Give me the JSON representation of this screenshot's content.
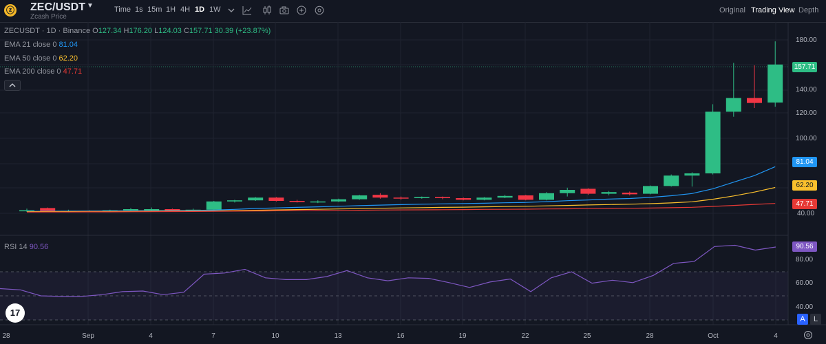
{
  "header": {
    "coin_logo": "zcash-logo-icon",
    "symbol": "ZEC/USDT",
    "subtitle": "Zcash Price",
    "toolbar": [
      "Time",
      "1s",
      "15m",
      "1H",
      "4H",
      "1D",
      "1W"
    ],
    "active_interval": "1D",
    "tool_icons": [
      "chevron-down-icon",
      "indicator-icon",
      "candle-style-icon",
      "camera-icon",
      "plus-circle-icon",
      "settings-icon"
    ],
    "views": [
      "Original",
      "Trading View",
      "Depth"
    ],
    "active_view": "Trading View"
  },
  "legend": {
    "title": "ZECUSDT · 1D · Binance",
    "open_label": "O",
    "open": "127.34",
    "high_label": "H",
    "high": "176.20",
    "low_label": "L",
    "low": "124.03",
    "close_label": "C",
    "close": "157.71",
    "change": "30.39 (+23.87%)",
    "ema21_label": "EMA 21 close 0",
    "ema21": "81.04",
    "ema50_label": "EMA 50 close 0",
    "ema50": "62.20",
    "ema200_label": "EMA 200 close 0",
    "ema200": "47.71"
  },
  "rsi": {
    "label": "RSI 14",
    "value": "90.56"
  },
  "colors": {
    "up": "#26a69a",
    "up_body": "#2ebd85",
    "down": "#f23645",
    "ema21": "#2196f3",
    "ema50": "#fbc02d",
    "ema200": "#e53935",
    "rsi": "#7e57c2",
    "background": "#131722"
  },
  "price_tags": {
    "last": "157.71",
    "ema21": "81.04",
    "ema50": "62.20",
    "ema200": "47.71",
    "rsi": "90.56"
  },
  "price_axis": [
    "180.00",
    "160.00",
    "140.00",
    "120.00",
    "100.00",
    "40.00"
  ],
  "rsi_axis": [
    "80.00",
    "60.00",
    "40.00"
  ],
  "x_axis": [
    "28",
    "Sep",
    "4",
    "7",
    "10",
    "13",
    "16",
    "19",
    "22",
    "25",
    "28",
    "Oct",
    "4"
  ],
  "bottom_buttons": {
    "auto": "A",
    "log": "L"
  },
  "chart_data": {
    "type": "candlestick",
    "title": "ZECUSDT · 1D · Binance",
    "ylim": [
      36,
      186
    ],
    "candles": [
      {
        "o": 41.5,
        "h": 43.0,
        "l": 40.0,
        "c": 41.5
      },
      {
        "o": 43.5,
        "h": 44.0,
        "l": 40.5,
        "c": 41.0
      },
      {
        "o": 41.0,
        "h": 42.0,
        "l": 40.0,
        "c": 41.0
      },
      {
        "o": 40.5,
        "h": 41.5,
        "l": 40.0,
        "c": 41.0
      },
      {
        "o": 41.0,
        "h": 42.0,
        "l": 40.0,
        "c": 41.5
      },
      {
        "o": 41.5,
        "h": 43.5,
        "l": 40.5,
        "c": 42.5
      },
      {
        "o": 42.0,
        "h": 44.0,
        "l": 41.0,
        "c": 42.5
      },
      {
        "o": 42.5,
        "h": 43.0,
        "l": 41.0,
        "c": 42.0
      },
      {
        "o": 42.0,
        "h": 43.0,
        "l": 41.0,
        "c": 42.0
      },
      {
        "o": 42.0,
        "h": 50.0,
        "l": 41.5,
        "c": 49.5
      },
      {
        "o": 49.5,
        "h": 51.0,
        "l": 48.5,
        "c": 50.5
      },
      {
        "o": 50.5,
        "h": 53.5,
        "l": 50.0,
        "c": 53.0
      },
      {
        "o": 53.0,
        "h": 53.5,
        "l": 49.5,
        "c": 50.0
      },
      {
        "o": 50.0,
        "h": 51.0,
        "l": 48.5,
        "c": 49.0
      },
      {
        "o": 49.0,
        "h": 50.5,
        "l": 48.0,
        "c": 49.5
      },
      {
        "o": 49.5,
        "h": 52.0,
        "l": 49.0,
        "c": 51.5
      },
      {
        "o": 51.5,
        "h": 55.5,
        "l": 51.0,
        "c": 55.0
      },
      {
        "o": 55.5,
        "h": 57.0,
        "l": 52.0,
        "c": 53.0
      },
      {
        "o": 53.0,
        "h": 54.0,
        "l": 51.0,
        "c": 52.5
      },
      {
        "o": 52.5,
        "h": 54.0,
        "l": 52.0,
        "c": 53.5
      },
      {
        "o": 53.5,
        "h": 54.0,
        "l": 51.5,
        "c": 52.5
      },
      {
        "o": 52.5,
        "h": 53.0,
        "l": 50.5,
        "c": 51.0
      },
      {
        "o": 51.0,
        "h": 53.5,
        "l": 50.5,
        "c": 53.0
      },
      {
        "o": 53.0,
        "h": 55.5,
        "l": 52.5,
        "c": 54.5
      },
      {
        "o": 55.0,
        "h": 55.5,
        "l": 50.5,
        "c": 51.0
      },
      {
        "o": 51.0,
        "h": 58.0,
        "l": 50.5,
        "c": 57.0
      },
      {
        "o": 57.0,
        "h": 62.0,
        "l": 54.0,
        "c": 60.0
      },
      {
        "o": 61.0,
        "h": 61.5,
        "l": 55.5,
        "c": 56.5
      },
      {
        "o": 56.5,
        "h": 59.0,
        "l": 55.0,
        "c": 58.0
      },
      {
        "o": 57.5,
        "h": 58.5,
        "l": 55.0,
        "c": 56.0
      },
      {
        "o": 56.5,
        "h": 64.0,
        "l": 56.0,
        "c": 63.5
      },
      {
        "o": 63.5,
        "h": 74.0,
        "l": 63.0,
        "c": 73.0
      },
      {
        "o": 73.0,
        "h": 76.0,
        "l": 63.0,
        "c": 75.0
      },
      {
        "o": 75.0,
        "h": 126.0,
        "l": 74.0,
        "c": 120.0
      },
      {
        "o": 120.0,
        "h": 159.0,
        "l": 116.0,
        "c": 131.0
      },
      {
        "o": 131.0,
        "h": 157.0,
        "l": 123.0,
        "c": 127.0
      },
      {
        "o": 127.34,
        "h": 176.2,
        "l": 124.03,
        "c": 157.71
      }
    ],
    "series": [
      {
        "name": "EMA 21",
        "values": [
          40.5,
          40.6,
          40.7,
          40.8,
          40.9,
          41.0,
          41.1,
          41.2,
          41.3,
          41.6,
          42.3,
          43.1,
          43.6,
          44.1,
          44.6,
          45.1,
          45.7,
          46.2,
          46.6,
          47.0,
          47.3,
          47.6,
          47.9,
          48.3,
          48.6,
          49.3,
          50.2,
          50.9,
          51.6,
          52.2,
          53.2,
          54.7,
          56.7,
          61.0,
          67.0,
          73.0,
          81.04
        ]
      },
      {
        "name": "EMA 50",
        "values": [
          40.2,
          40.3,
          40.3,
          40.4,
          40.4,
          40.5,
          40.6,
          40.7,
          40.8,
          40.9,
          41.2,
          41.5,
          41.8,
          42.1,
          42.4,
          42.7,
          43.0,
          43.3,
          43.6,
          43.8,
          44.1,
          44.3,
          44.6,
          44.9,
          45.1,
          45.5,
          45.9,
          46.3,
          46.7,
          47.0,
          47.5,
          48.2,
          49.2,
          51.5,
          54.5,
          58.0,
          62.2
        ]
      },
      {
        "name": "EMA 200",
        "values": [
          39.8,
          39.9,
          39.9,
          40.0,
          40.0,
          40.1,
          40.2,
          40.3,
          40.4,
          40.5,
          40.7,
          40.8,
          41.0,
          41.1,
          41.2,
          41.4,
          41.5,
          41.7,
          41.8,
          41.9,
          42.0,
          42.1,
          42.3,
          42.4,
          42.5,
          42.7,
          42.8,
          43.0,
          43.2,
          43.3,
          43.5,
          43.8,
          44.2,
          45.0,
          45.9,
          46.8,
          47.71
        ]
      }
    ],
    "rsi": {
      "name": "RSI 14",
      "ylim": [
        30,
        95
      ],
      "bands": [
        30,
        50,
        70
      ],
      "values": [
        56,
        55,
        50,
        49.5,
        49.5,
        51,
        53.5,
        54,
        51,
        53,
        68,
        69,
        72,
        65,
        63.5,
        63.5,
        66,
        71,
        65,
        62.5,
        65,
        64.5,
        61,
        57,
        61.5,
        64,
        53.5,
        65,
        70,
        60.5,
        63,
        61,
        67,
        77,
        78.5,
        91,
        92,
        88,
        90.56
      ]
    }
  }
}
